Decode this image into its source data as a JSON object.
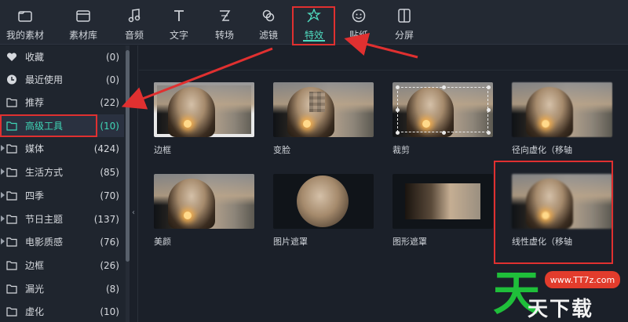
{
  "toolbar": {
    "items": [
      {
        "label": "我的素材",
        "icon": "folder-icon"
      },
      {
        "label": "素材库",
        "icon": "library-icon"
      },
      {
        "label": "音频",
        "icon": "music-note-icon"
      },
      {
        "label": "文字",
        "icon": "text-icon"
      },
      {
        "label": "转场",
        "icon": "transition-icon"
      },
      {
        "label": "滤镜",
        "icon": "filter-icon"
      },
      {
        "label": "特效",
        "icon": "magic-wand-icon"
      },
      {
        "label": "贴纸",
        "icon": "sticker-icon"
      },
      {
        "label": "分屏",
        "icon": "split-screen-icon"
      }
    ],
    "active": "特效"
  },
  "sidebar": {
    "items": [
      {
        "label": "收藏",
        "count": "(0)",
        "icon": "heart-icon"
      },
      {
        "label": "最近使用",
        "count": "(0)",
        "icon": "clock-icon"
      },
      {
        "label": "推荐",
        "count": "(22)",
        "icon": "folder-icon"
      },
      {
        "label": "高级工具",
        "count": "(10)",
        "icon": "folder-icon"
      },
      {
        "label": "媒体",
        "count": "(424)",
        "icon": "folder-icon"
      },
      {
        "label": "生活方式",
        "count": "(85)",
        "icon": "folder-icon"
      },
      {
        "label": "四季",
        "count": "(70)",
        "icon": "folder-icon"
      },
      {
        "label": "节日主题",
        "count": "(137)",
        "icon": "folder-icon"
      },
      {
        "label": "电影质感",
        "count": "(76)",
        "icon": "folder-icon"
      },
      {
        "label": "边框",
        "count": "(26)",
        "icon": "folder-icon"
      },
      {
        "label": "漏光",
        "count": "(8)",
        "icon": "folder-icon"
      },
      {
        "label": "虚化",
        "count": "(10)",
        "icon": "folder-icon"
      }
    ],
    "active": "高级工具"
  },
  "effects": [
    {
      "label": "边框",
      "style": "framed"
    },
    {
      "label": "变脸",
      "style": "mosaic"
    },
    {
      "label": "裁剪",
      "style": "crop"
    },
    {
      "label": "径向虚化（移轴",
      "style": "radial-blur"
    },
    {
      "label": "美颜",
      "style": "beauty"
    },
    {
      "label": "图片遮罩",
      "style": "circle-mask"
    },
    {
      "label": "图形遮罩",
      "style": "shape-mask"
    },
    {
      "label": "线性虚化（移轴",
      "style": "linear-blur"
    }
  ],
  "watermark": {
    "url": "www.TT7z.com",
    "text": "天下载",
    "logo": "天"
  },
  "colors": {
    "accent": "#4fdcc0",
    "highlight": "#e03030",
    "background": "#1b2029"
  }
}
